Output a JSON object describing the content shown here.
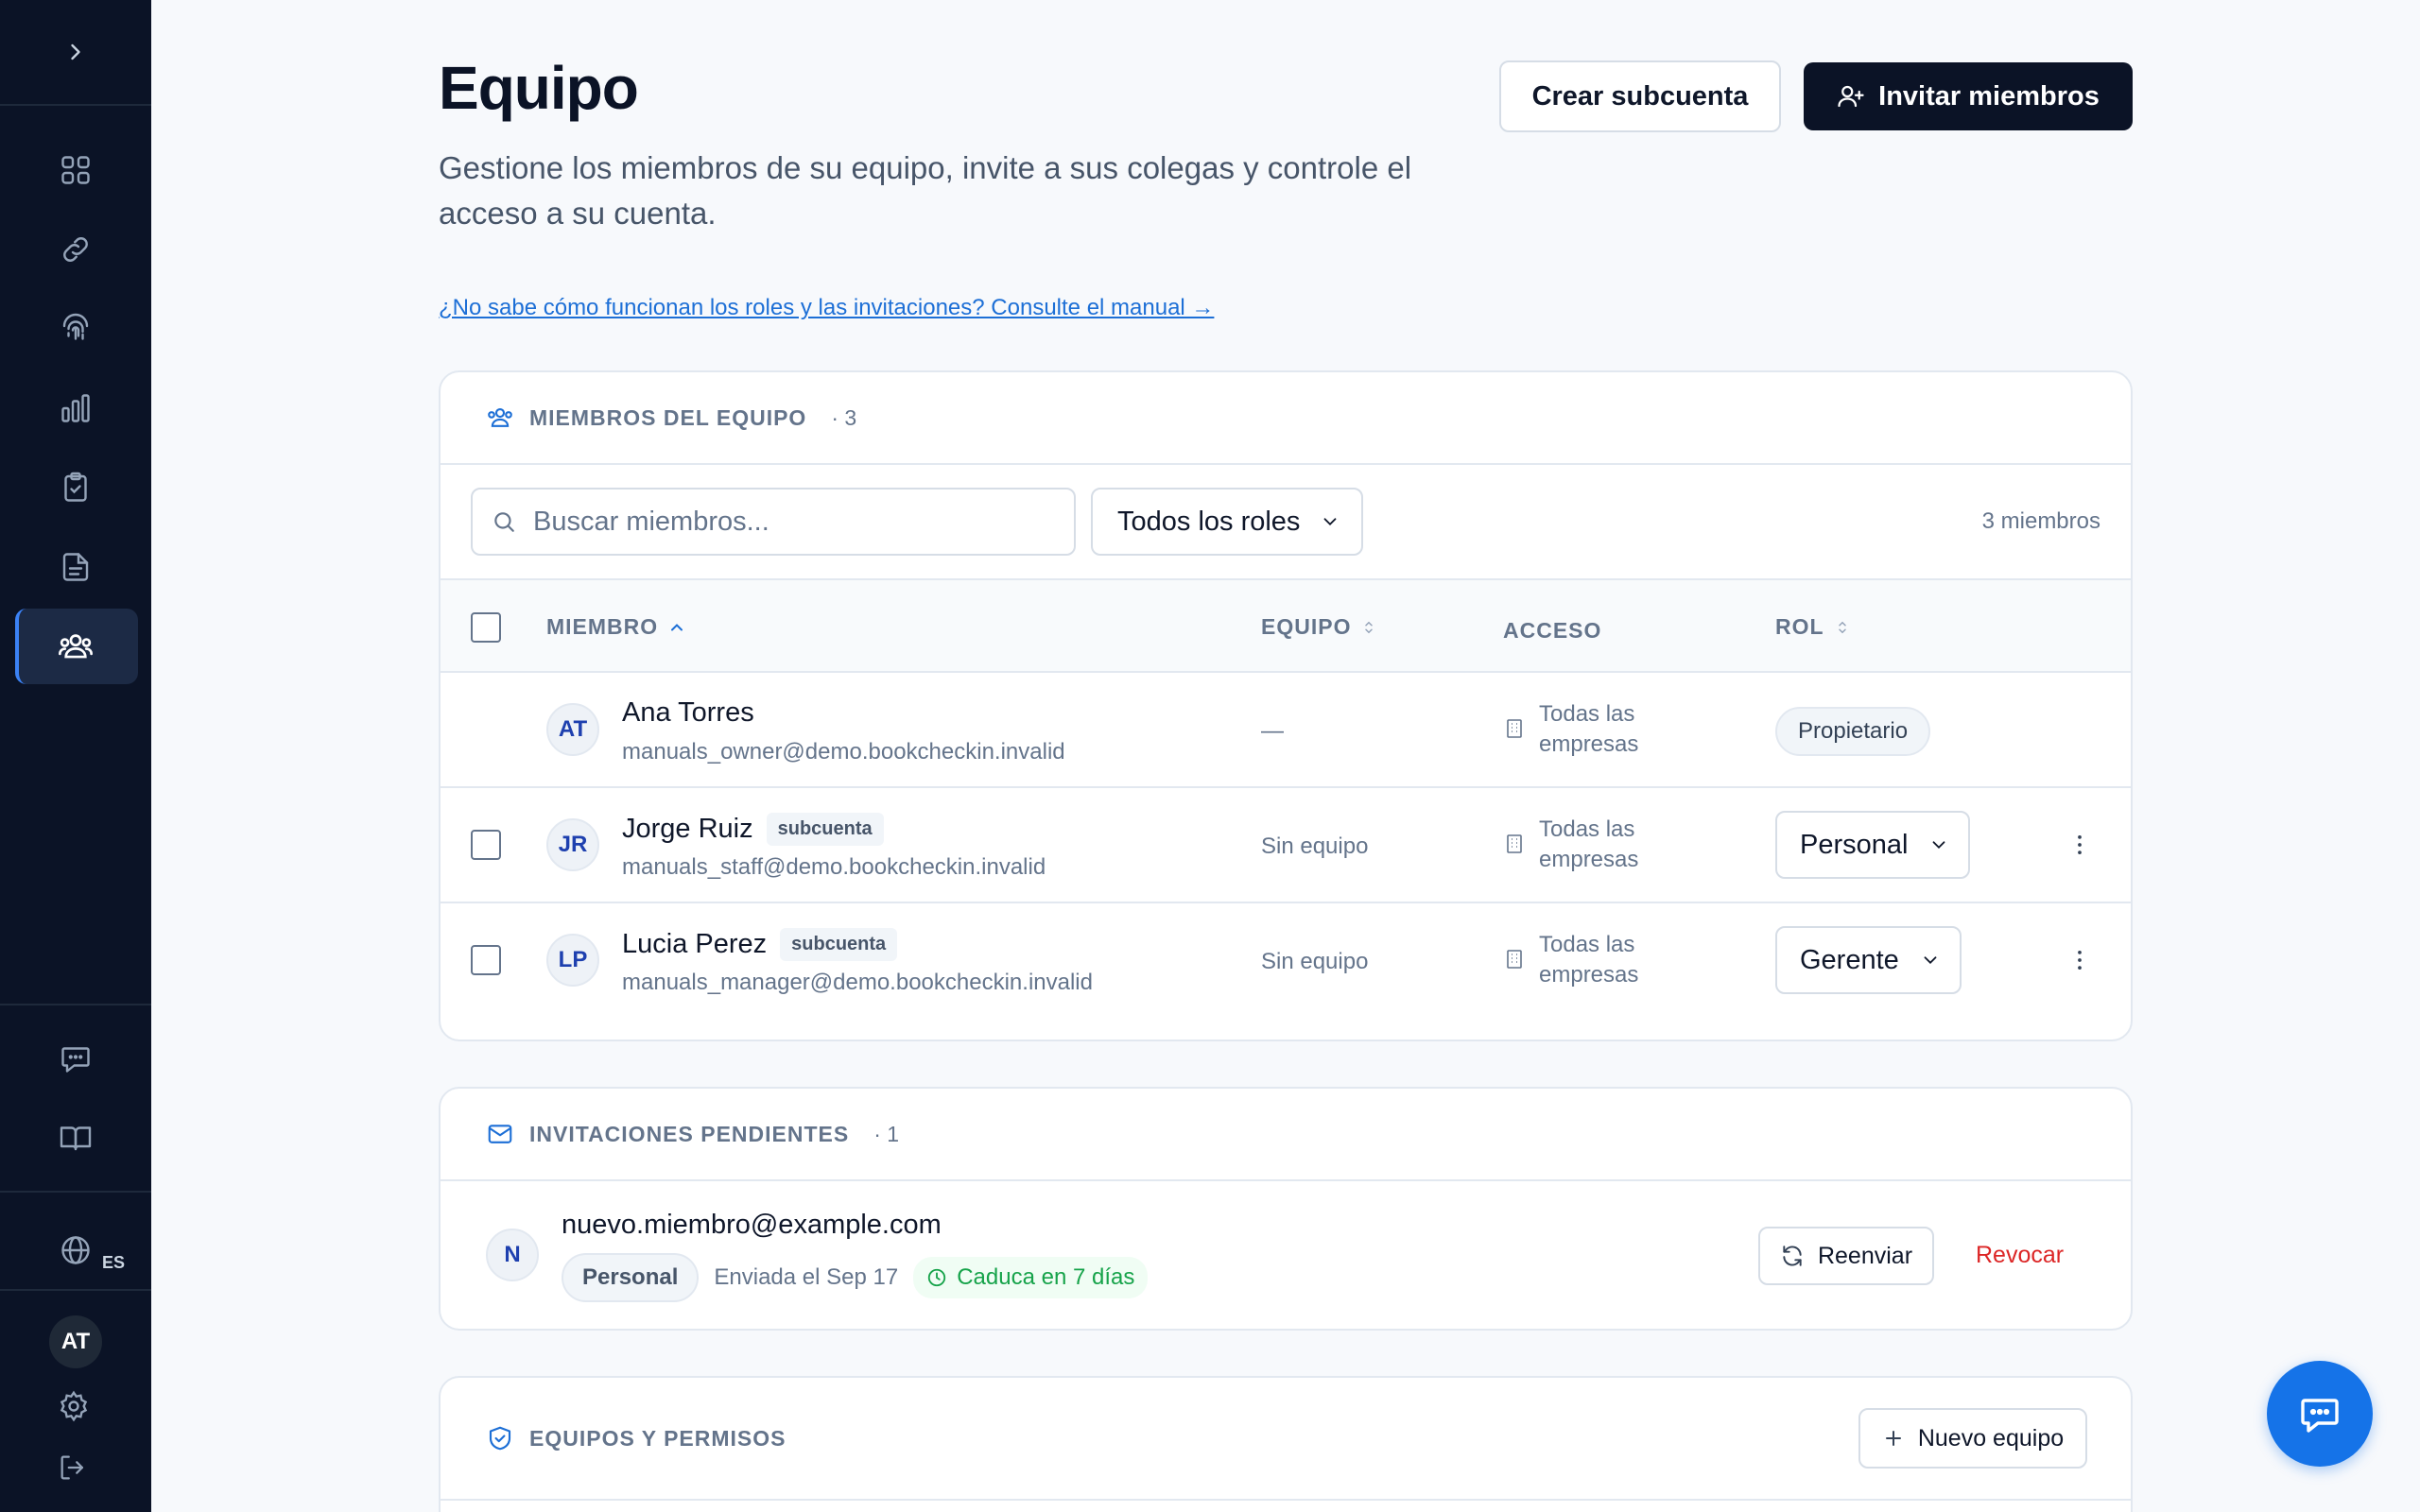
{
  "sidebar": {
    "items": [
      "dashboard",
      "links",
      "identity",
      "analytics",
      "checklists",
      "documents",
      "team"
    ],
    "active": "team",
    "language_code": "ES",
    "user_initials": "AT"
  },
  "header": {
    "title": "Equipo",
    "description": "Gestione los miembros de su equipo, invite a sus colegas y controle el acceso a su cuenta.",
    "create_subaccount_label": "Crear subcuenta",
    "invite_label": "Invitar miembros",
    "manual_link": "¿No sabe cómo funcionan los roles y las invitaciones? Consulte el manual →"
  },
  "members": {
    "section_label": "MIEMBROS DEL EQUIPO",
    "count_label": "· 3",
    "search_placeholder": "Buscar miembros...",
    "role_filter": "Todos los roles",
    "total_label": "3 miembros",
    "columns": {
      "member": "MIEMBRO",
      "team": "EQUIPO",
      "access": "ACCESO",
      "role": "ROL"
    },
    "rows": [
      {
        "initials": "AT",
        "name": "Ana Torres",
        "tag": "",
        "email": "manuals_owner@demo.bookcheckin.invalid",
        "team": "—",
        "access": "Todas las empresas",
        "role": "Propietario"
      },
      {
        "initials": "JR",
        "name": "Jorge Ruiz",
        "tag": "subcuenta",
        "email": "manuals_staff@demo.bookcheckin.invalid",
        "team": "Sin equipo",
        "access": "Todas las empresas",
        "role": "Personal"
      },
      {
        "initials": "LP",
        "name": "Lucia Perez",
        "tag": "subcuenta",
        "email": "manuals_manager@demo.bookcheckin.invalid",
        "team": "Sin equipo",
        "access": "Todas las empresas",
        "role": "Gerente"
      }
    ]
  },
  "invitations": {
    "section_label": "INVITACIONES PENDIENTES",
    "count_label": "· 1",
    "items": [
      {
        "initial": "N",
        "email": "nuevo.miembro@example.com",
        "role": "Personal",
        "sent": "Enviada el Sep 17",
        "expires": "Caduca en 7 días",
        "resend_label": "Reenviar",
        "revoke_label": "Revocar"
      }
    ]
  },
  "teams": {
    "section_label": "EQUIPOS Y PERMISOS",
    "new_team_label": "Nuevo equipo"
  },
  "colors": {
    "sidebar_bg": "#0b1326",
    "primary_button": "#0b1326",
    "link": "#1d6fd6",
    "revoke": "#dc2626",
    "expiry": "#16a34a",
    "fab": "#1573e8"
  }
}
